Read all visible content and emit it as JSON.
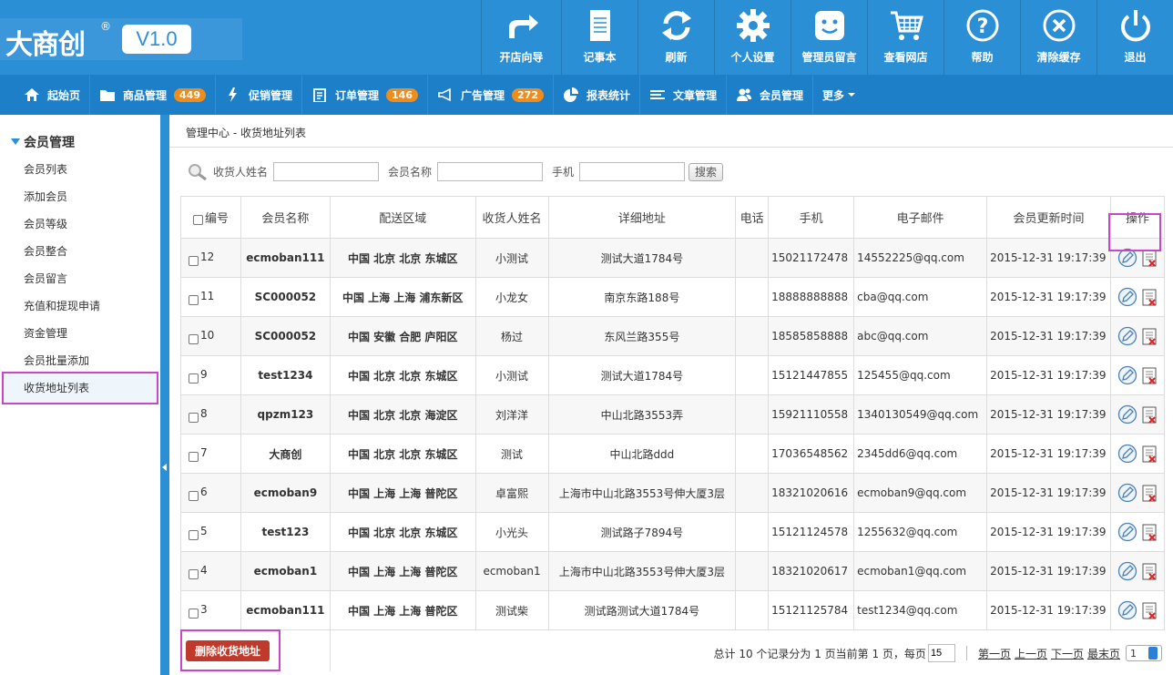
{
  "brand": {
    "name": "大商创",
    "reg": "®",
    "version": "V1.0"
  },
  "top_nav": [
    {
      "label": "开店向导",
      "icon": "forward-arrow-icon"
    },
    {
      "label": "记事本",
      "icon": "notepad-icon"
    },
    {
      "label": "刷新",
      "icon": "refresh-icon"
    },
    {
      "label": "个人设置",
      "icon": "gear-icon"
    },
    {
      "label": "管理员留言",
      "icon": "smiley-message-icon"
    },
    {
      "label": "查看网店",
      "icon": "cart-icon"
    },
    {
      "label": "帮助",
      "icon": "help-icon"
    },
    {
      "label": "清除缓存",
      "icon": "clear-icon"
    },
    {
      "label": "退出",
      "icon": "power-icon"
    }
  ],
  "main_nav": [
    {
      "label": "起始页",
      "icon": "home-icon",
      "badge": ""
    },
    {
      "label": "商品管理",
      "icon": "folder-icon",
      "badge": "449"
    },
    {
      "label": "促销管理",
      "icon": "bolt-icon",
      "badge": ""
    },
    {
      "label": "订单管理",
      "icon": "order-icon",
      "badge": "146"
    },
    {
      "label": "广告管理",
      "icon": "megaphone-icon",
      "badge": "272"
    },
    {
      "label": "报表统计",
      "icon": "pie-chart-icon",
      "badge": ""
    },
    {
      "label": "文章管理",
      "icon": "list-icon",
      "badge": ""
    },
    {
      "label": "会员管理",
      "icon": "users-icon",
      "badge": ""
    },
    {
      "label": "更多",
      "icon": "caret-down-icon",
      "badge": ""
    }
  ],
  "sidebar": {
    "section": "会员管理",
    "items": [
      "会员列表",
      "添加会员",
      "会员等级",
      "会员整合",
      "会员留言",
      "充值和提现申请",
      "资金管理",
      "会员批量添加",
      "收货地址列表"
    ],
    "active": "收货地址列表"
  },
  "breadcrumb": {
    "root": "管理中心",
    "sep": " - ",
    "current": "收货地址列表"
  },
  "search": {
    "consignee_label": "收货人姓名",
    "member_label": "会员名称",
    "phone_label": "手机",
    "button": "搜索"
  },
  "table": {
    "headers": [
      "编号",
      "会员名称",
      "配送区域",
      "收货人姓名",
      "详细地址",
      "电话",
      "手机",
      "电子邮件",
      "会员更新时间",
      "操作"
    ],
    "rows": [
      {
        "id": "12",
        "member": "ecmoban111",
        "region": "中国 北京 北京 东城区",
        "consignee": "小测试",
        "address": "测试大道1784号",
        "tel": "",
        "mobile": "15021172478",
        "email": "14552225@qq.com",
        "time": "2015-12-31 19:17:39"
      },
      {
        "id": "11",
        "member": "SC000052",
        "region": "中国 上海 上海 浦东新区",
        "consignee": "小龙女",
        "address": "南京东路188号",
        "tel": "",
        "mobile": "18888888888",
        "email": "cba@qq.com",
        "time": "2015-12-31 19:17:39"
      },
      {
        "id": "10",
        "member": "SC000052",
        "region": "中国 安徽 合肥 庐阳区",
        "consignee": "杨过",
        "address": "东风兰路355号",
        "tel": "",
        "mobile": "18585858888",
        "email": "abc@qq.com",
        "time": "2015-12-31 19:17:39"
      },
      {
        "id": "9",
        "member": "test1234",
        "region": "中国 北京 北京 东城区",
        "consignee": "小测试",
        "address": "测试大道1784号",
        "tel": "",
        "mobile": "15121447855",
        "email": "125455@qq.com",
        "time": "2015-12-31 19:17:39"
      },
      {
        "id": "8",
        "member": "qpzm123",
        "region": "中国 北京 北京 海淀区",
        "consignee": "刘洋洋",
        "address": "中山北路3553弄",
        "tel": "",
        "mobile": "15921110558",
        "email": "1340130549@qq.com",
        "time": "2015-12-31 19:17:39"
      },
      {
        "id": "7",
        "member": "大商创",
        "region": "中国 北京 北京 东城区",
        "consignee": "测试",
        "address": "中山北路ddd",
        "tel": "",
        "mobile": "17036548562",
        "email": "2345dd6@qq.com",
        "time": "2015-12-31 19:17:39"
      },
      {
        "id": "6",
        "member": "ecmoban9",
        "region": "中国 上海 上海 普陀区",
        "consignee": "卓富熙",
        "address": "上海市中山北路3553号伸大厦3层",
        "tel": "",
        "mobile": "18321020616",
        "email": "ecmoban9@qq.com",
        "time": "2015-12-31 19:17:39"
      },
      {
        "id": "5",
        "member": "test123",
        "region": "中国 北京 北京 东城区",
        "consignee": "小光头",
        "address": "测试路子7894号",
        "tel": "",
        "mobile": "15121124578",
        "email": "1255632@qq.com",
        "time": "2015-12-31 19:17:39"
      },
      {
        "id": "4",
        "member": "ecmoban1",
        "region": "中国 上海 上海 普陀区",
        "consignee": "ecmoban1",
        "address": "上海市中山北路3553号伸大厦3层",
        "tel": "",
        "mobile": "18321020617",
        "email": "ecmoban1@qq.com",
        "time": "2015-12-31 19:17:39"
      },
      {
        "id": "3",
        "member": "ecmoban111",
        "region": "中国 上海 上海 普陀区",
        "consignee": "测试柴",
        "address": "测试路测试大道1784号",
        "tel": "",
        "mobile": "15121125784",
        "email": "test1234@qq.com",
        "time": "2015-12-31 19:17:39"
      }
    ]
  },
  "footer": {
    "delete_button": "删除收货地址",
    "summary_prefix": "总计 10 个记录分为 1 页当前第 1 页，每页",
    "per_page": "15",
    "first": "第一页",
    "prev": "上一页",
    "next": "下一页",
    "last": "最末页",
    "page_select": "1"
  },
  "colors": {
    "topbar": "#2b8fd6",
    "navbar": "#1d7fc8",
    "badge": "#ef8c1e",
    "highlight": "#c846c8",
    "delete": "#c0392b"
  }
}
